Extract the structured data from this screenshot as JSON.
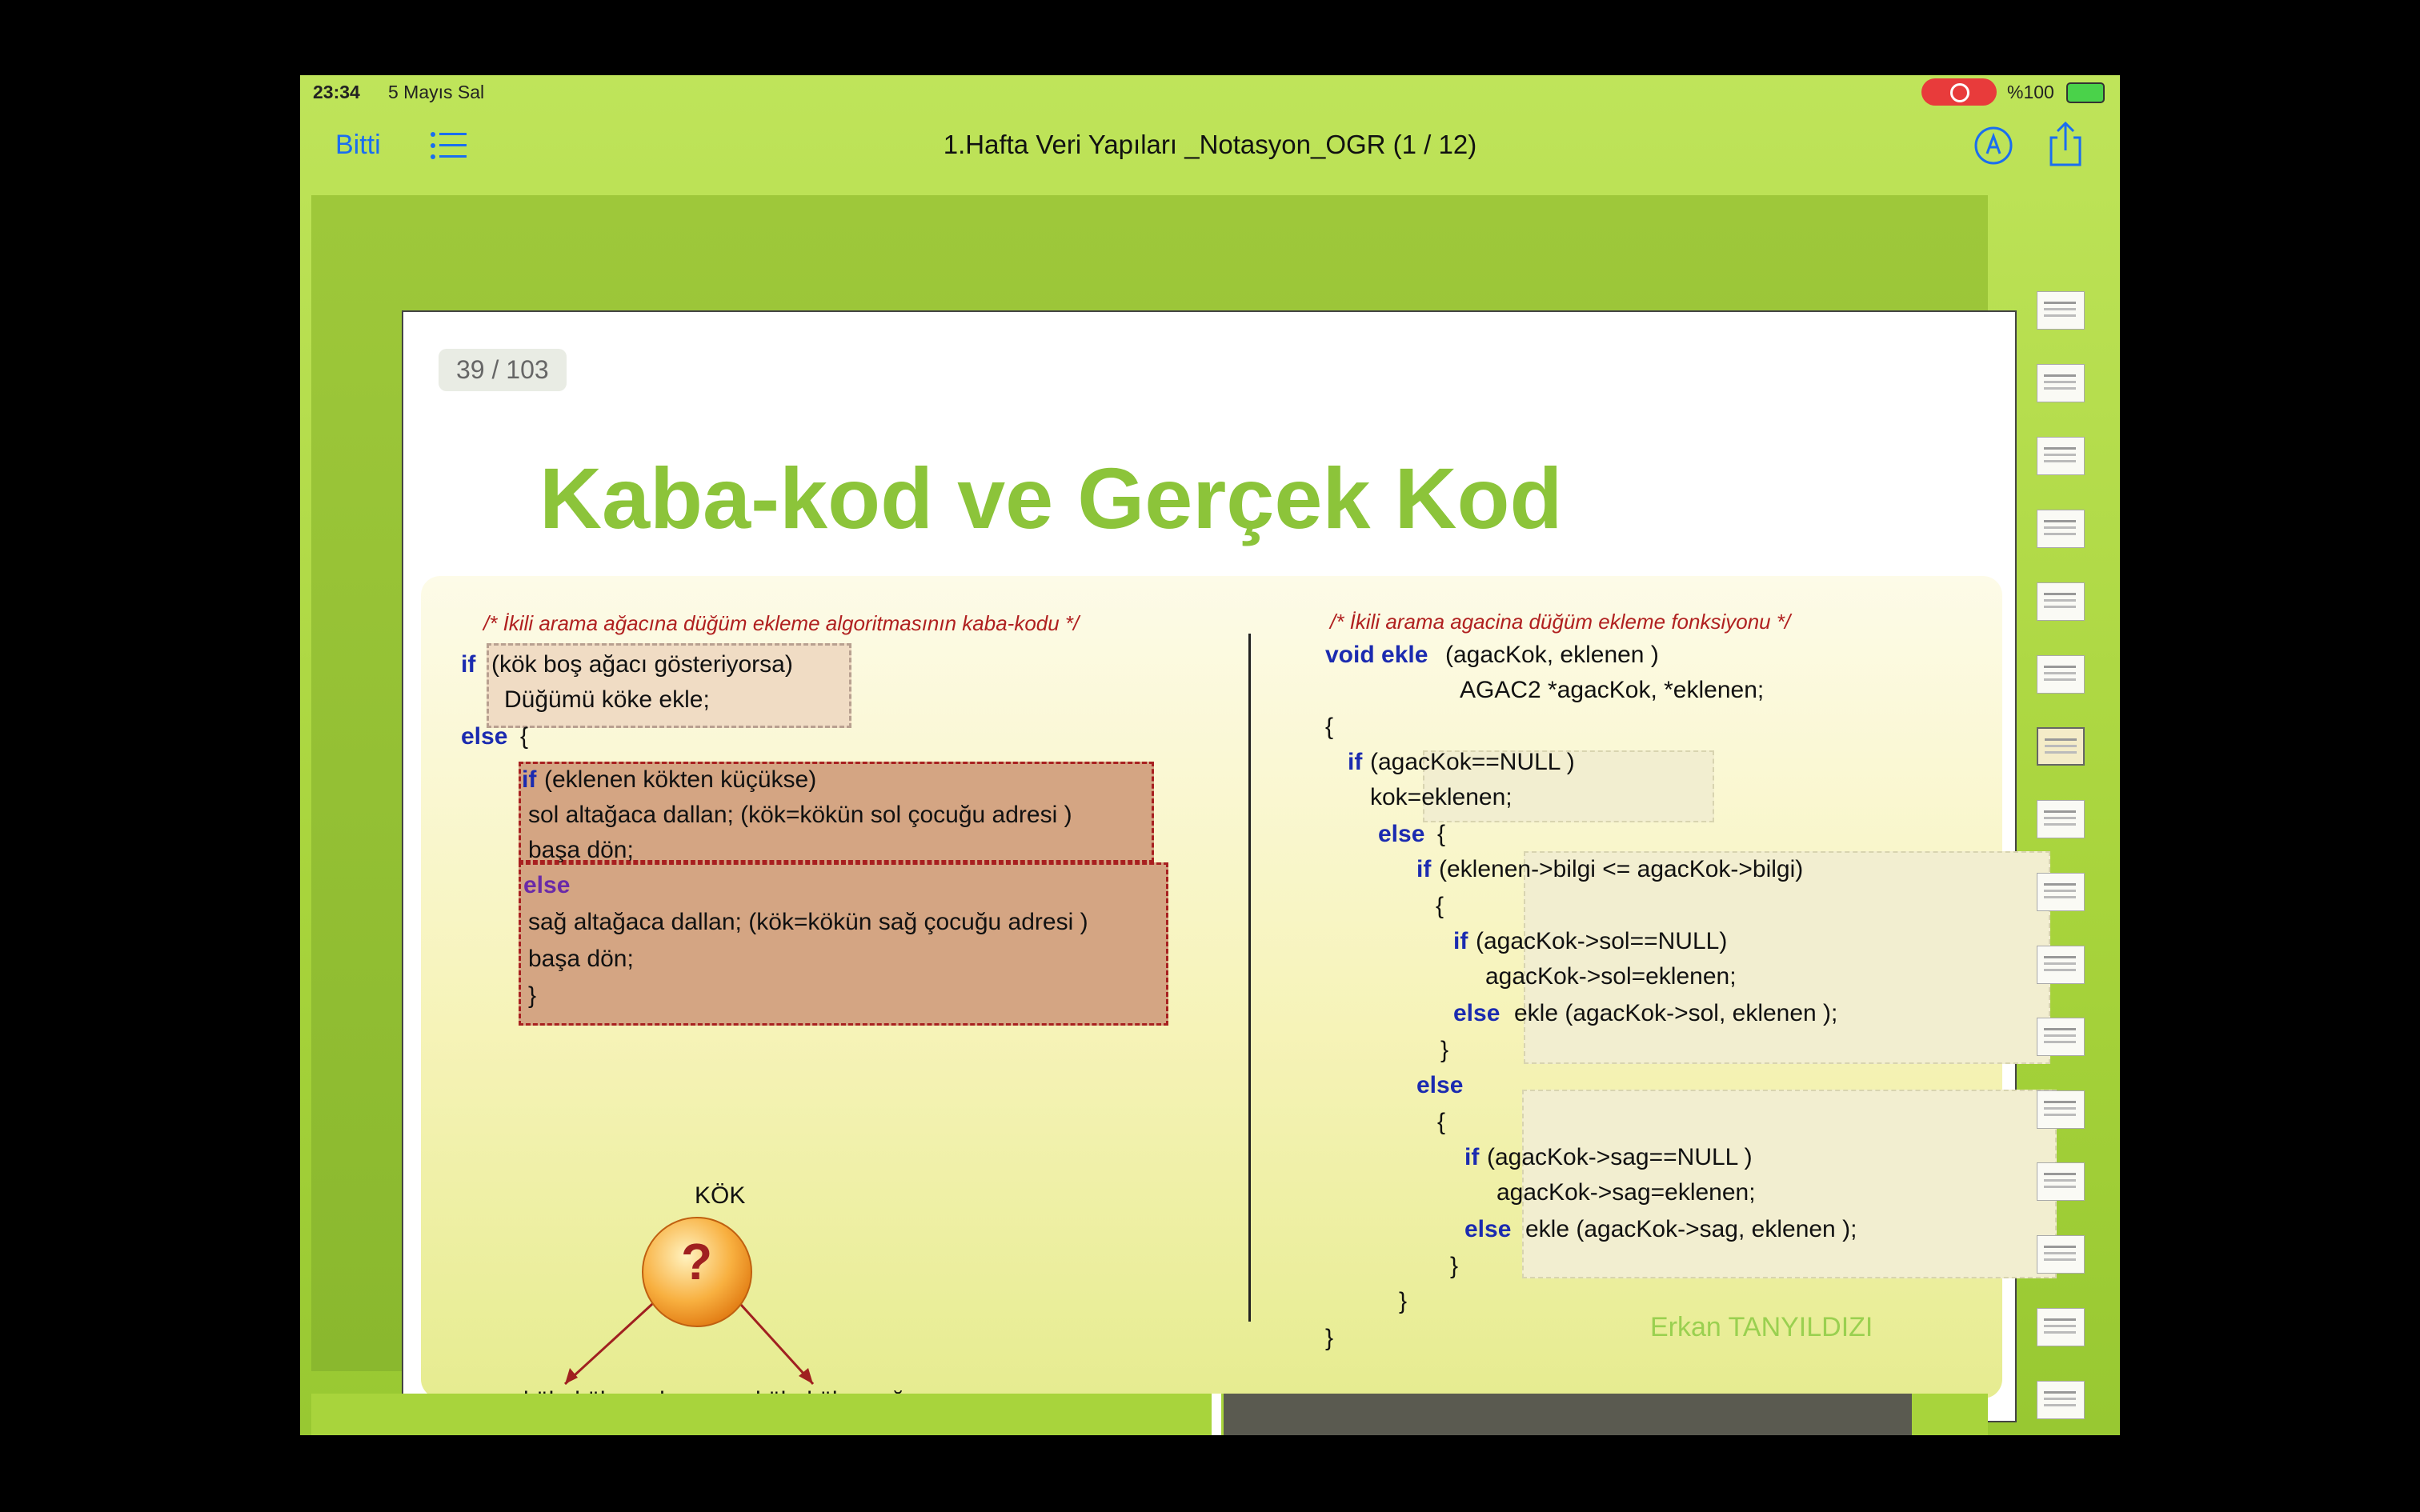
{
  "status_bar": {
    "time": "23:34",
    "date": "5 Mayıs Sal",
    "battery": "%100"
  },
  "nav": {
    "done_label": "Bitti",
    "title": "1.Hafta Veri Yapıları _Notasyon_OGR (1 / 12)"
  },
  "slide": {
    "page_badge": "39 / 103",
    "title": "Kaba-kod ve Gerçek Kod",
    "left": {
      "comment": "/* İkili arama ağacına düğüm ekleme algoritmasının kaba-kodu */",
      "kw_if1": "if",
      "l1": "(kök boş ağacı gösteriyorsa)",
      "l2": "Düğümü köke ekle;",
      "kw_else1": "else",
      "brace_open": "{",
      "kw_if2": "if",
      "l3": "(eklenen kökten küçükse)",
      "l4": "sol altağaca dallan; (kök=kökün sol çocuğu adresi )",
      "l5": "başa dön;",
      "kw_else2": "else",
      "l6": "sağ altağaca dallan; (kök=kökün sağ çocuğu adresi )",
      "l7": "başa dön;",
      "brace_close": "}"
    },
    "diagram": {
      "root_label": "KÖK",
      "node_text": "?",
      "left_label": "kök=kök->sol",
      "right_label": "kök=kök->sağ"
    },
    "right": {
      "comment": "/* İkili arama agacina düğüm ekleme fonksiyonu */",
      "kw_void": "void ekle",
      "r1": "(agacKok, eklenen )",
      "r2": "AGAC2 *agacKok, *eklenen;",
      "r3": "{",
      "kw_if1": "if",
      "r4": "(agacKok==NULL )",
      "r5": "kok=eklenen;",
      "kw_else1": "else",
      "r6": "{",
      "kw_if2": "if",
      "r7": "(eklenen->bilgi <= agacKok->bilgi)",
      "r8": "{",
      "kw_if3": "if",
      "r9": "(agacKok->sol==NULL)",
      "r10": "agacKok->sol=eklenen;",
      "kw_else2": "else",
      "r11": "ekle (agacKok->sol, eklenen );",
      "r12": "}",
      "kw_else3": "else",
      "r13": "{",
      "kw_if4": "if",
      "r14": "(agacKok->sag==NULL )",
      "r15": "agacKok->sag=eklenen;",
      "kw_else4": "else",
      "r16": "ekle (agacKok->sag, eklenen );",
      "r17": "}",
      "r18": "}",
      "r19": "}"
    },
    "author": "Erkan TANYILDIZI"
  },
  "colors": {
    "accent": "#1a6ef0",
    "title_green": "#8cc43a",
    "keyword": "#1b2bb0",
    "comment": "#b02020"
  }
}
